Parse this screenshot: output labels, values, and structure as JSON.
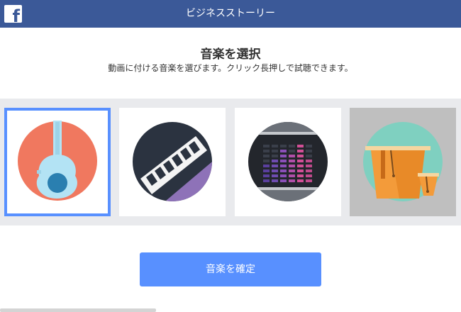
{
  "header": {
    "logo_icon": "facebook-f-icon",
    "title": "ビジネスストーリー"
  },
  "main": {
    "heading": "音楽を選択",
    "subheading": "動画に付ける音楽を選びます。クリック長押しで試聴できます。"
  },
  "music_options": [
    {
      "icon": "guitar-icon",
      "selected": true
    },
    {
      "icon": "keyboard-icon",
      "selected": false
    },
    {
      "icon": "equalizer-icon",
      "selected": false
    },
    {
      "icon": "drums-icon",
      "selected": false
    }
  ],
  "footer": {
    "confirm_label": "音楽を確定"
  },
  "colors": {
    "brand": "#3b5998",
    "accent": "#5890ff",
    "strip_background": "#e9eaed"
  }
}
